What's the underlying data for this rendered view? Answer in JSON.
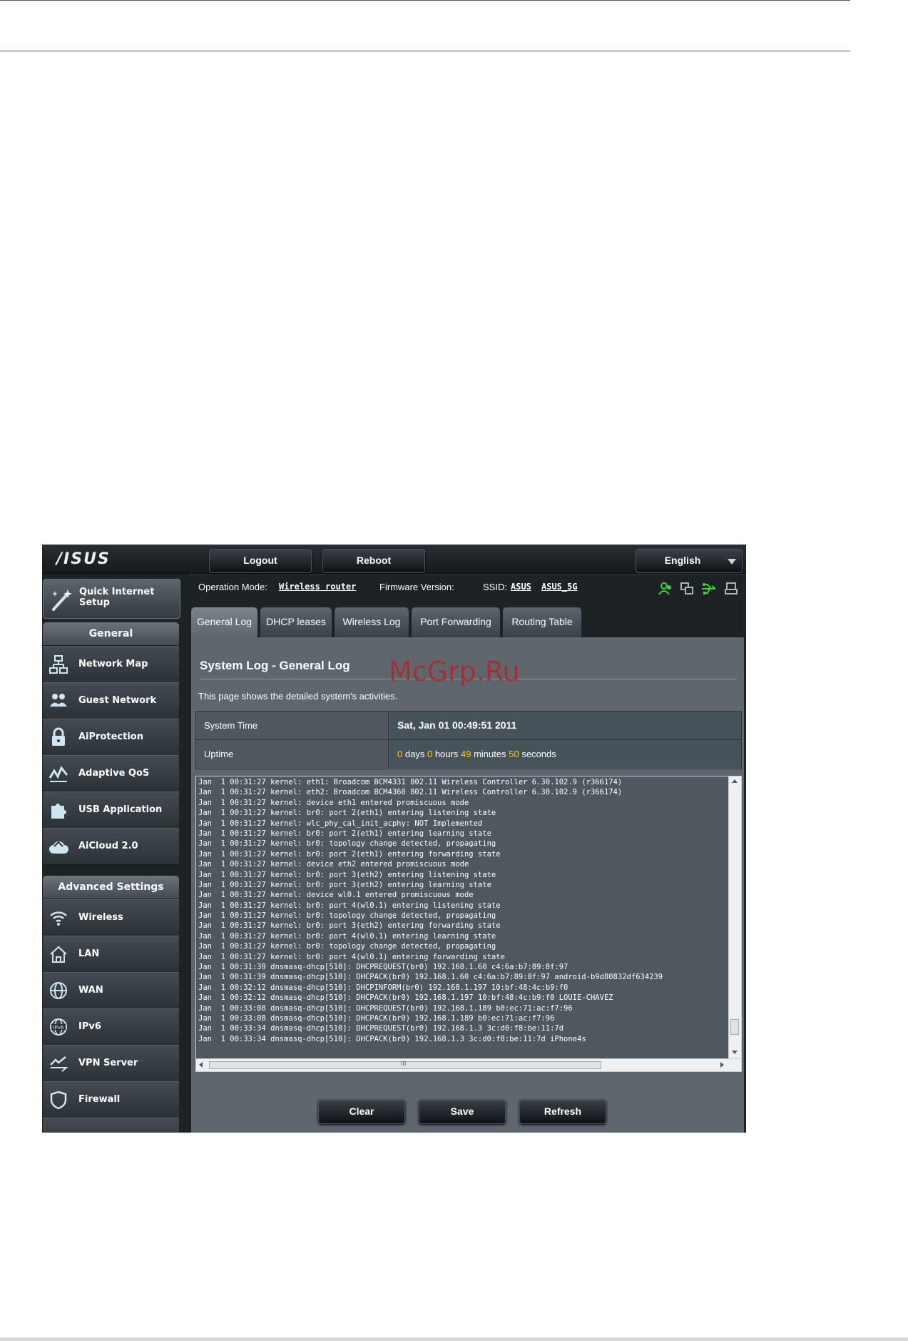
{
  "header": {
    "logo": "/ISUS",
    "logout_label": "Logout",
    "reboot_label": "Reboot",
    "language": "English"
  },
  "sidebar": {
    "qis_label_line1": "Quick Internet",
    "qis_label_line2": "Setup",
    "general_heading": "General",
    "general_items": [
      {
        "label": "Network Map",
        "icon": "network-map-icon"
      },
      {
        "label": "Guest Network",
        "icon": "guest-network-icon"
      },
      {
        "label": "AiProtection",
        "icon": "lock-icon"
      },
      {
        "label": "Adaptive QoS",
        "icon": "qos-icon"
      },
      {
        "label": "USB Application",
        "icon": "puzzle-icon"
      },
      {
        "label": "AiCloud 2.0",
        "icon": "cloud-icon"
      }
    ],
    "advanced_heading": "Advanced Settings",
    "advanced_items": [
      {
        "label": "Wireless",
        "icon": "wifi-icon"
      },
      {
        "label": "LAN",
        "icon": "home-icon"
      },
      {
        "label": "WAN",
        "icon": "globe-icon"
      },
      {
        "label": "IPv6",
        "icon": "ipv6-globe-icon"
      },
      {
        "label": "VPN Server",
        "icon": "vpn-icon"
      },
      {
        "label": "Firewall",
        "icon": "shield-icon"
      }
    ]
  },
  "infobar": {
    "op_mode_label": "Operation Mode:",
    "op_mode_value": "Wireless router",
    "firmware_label": "Firmware Version:",
    "ssid_label": "SSID:",
    "ssid_1": "ASUS",
    "ssid_2": "ASUS_5G"
  },
  "tabs": [
    "General Log",
    "DHCP leases",
    "Wireless Log",
    "Port Forwarding",
    "Routing Table"
  ],
  "main": {
    "title": "System Log - General Log",
    "description": "This page shows the detailed system's activities.",
    "system_time_label": "System Time",
    "system_time_value": "Sat, Jan 01  00:49:51  2011",
    "uptime_label": "Uptime",
    "uptime": {
      "days": "0",
      "days_unit": "days",
      "hours": "0",
      "hours_unit": "hours",
      "minutes": "49",
      "minutes_unit": "minutes",
      "seconds": "50",
      "seconds_unit": "seconds"
    }
  },
  "log_lines": [
    "Jan  1 00:31:27 kernel: eth1: Broadcom BCM4331 802.11 Wireless Controller 6.30.102.9 (r366174)",
    "Jan  1 00:31:27 kernel: eth2: Broadcom BCM4360 802.11 Wireless Controller 6.30.102.9 (r366174)",
    "Jan  1 00:31:27 kernel: device eth1 entered promiscuous mode",
    "Jan  1 00:31:27 kernel: br0: port 2(eth1) entering listening state",
    "Jan  1 00:31:27 kernel: wlc_phy_cal_init_acphy: NOT Implemented",
    "Jan  1 00:31:27 kernel: br0: port 2(eth1) entering learning state",
    "Jan  1 00:31:27 kernel: br0: topology change detected, propagating",
    "Jan  1 00:31:27 kernel: br0: port 2(eth1) entering forwarding state",
    "Jan  1 00:31:27 kernel: device eth2 entered promiscuous mode",
    "Jan  1 00:31:27 kernel: br0: port 3(eth2) entering listening state",
    "Jan  1 00:31:27 kernel: br0: port 3(eth2) entering learning state",
    "Jan  1 00:31:27 kernel: device wl0.1 entered promiscuous mode",
    "Jan  1 00:31:27 kernel: br0: port 4(wl0.1) entering listening state",
    "Jan  1 00:31:27 kernel: br0: topology change detected, propagating",
    "Jan  1 00:31:27 kernel: br0: port 3(eth2) entering forwarding state",
    "Jan  1 00:31:27 kernel: br0: port 4(wl0.1) entering learning state",
    "Jan  1 00:31:27 kernel: br0: topology change detected, propagating",
    "Jan  1 00:31:27 kernel: br0: port 4(wl0.1) entering forwarding state",
    "Jan  1 00:31:39 dnsmasq-dhcp[510]: DHCPREQUEST(br0) 192.168.1.60 c4:6a:b7:89:8f:97",
    "Jan  1 00:31:39 dnsmasq-dhcp[510]: DHCPACK(br0) 192.168.1.60 c4:6a:b7:89:8f:97 android-b9d80832df634239",
    "Jan  1 00:32:12 dnsmasq-dhcp[510]: DHCPINFORM(br0) 192.168.1.197 10:bf:48:4c:b9:f0",
    "Jan  1 00:32:12 dnsmasq-dhcp[510]: DHCPACK(br0) 192.168.1.197 10:bf:48:4c:b9:f0 LOUIE-CHAVEZ",
    "Jan  1 00:33:08 dnsmasq-dhcp[510]: DHCPREQUEST(br0) 192.168.1.189 b0:ec:71:ac:f7:96",
    "Jan  1 00:33:08 dnsmasq-dhcp[510]: DHCPACK(br0) 192.168.1.189 b0:ec:71:ac:f7:96",
    "Jan  1 00:33:34 dnsmasq-dhcp[510]: DHCPREQUEST(br0) 192.168.1.3 3c:d0:f8:be:11:7d",
    "Jan  1 00:33:34 dnsmasq-dhcp[510]: DHCPACK(br0) 192.168.1.3 3c:d0:f8:be:11:7d iPhone4s"
  ],
  "log_scrollbar_grip": "III",
  "actions": {
    "clear": "Clear",
    "save": "Save",
    "refresh": "Refresh"
  },
  "watermark": "McGrp.Ru",
  "colors": {
    "highlight": "#ffcc00",
    "status_icon_green": "#3ed23e",
    "watermark": "#b0272d"
  }
}
